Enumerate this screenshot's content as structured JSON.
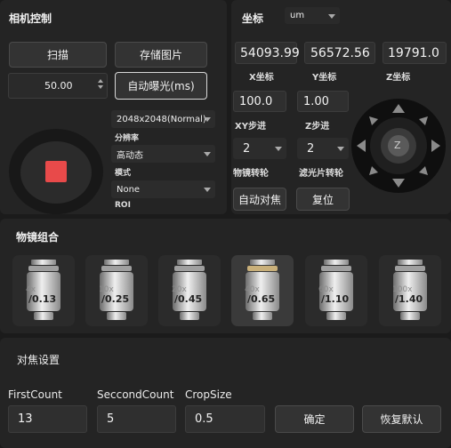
{
  "machine_control": {
    "title": "相机控制",
    "scan_label": "扫描",
    "save_image_label": "存储图片",
    "exposure_value": "50.00",
    "auto_exposure_label": "自动曝光(ms)",
    "resolution_value": "2048x2048(Normal)",
    "resolution_label": "分辨率",
    "mode_value": "高动态",
    "mode_label": "模式",
    "roi_value": "None",
    "roi_label": "ROI",
    "record_color": "#e84a4a"
  },
  "coordinates": {
    "title": "坐标",
    "unit_value": "um",
    "x_value": "54093.99",
    "y_value": "56572.56",
    "z_value": "19791.0",
    "x_label": "X坐标",
    "y_label": "Y坐标",
    "z_label": "Z坐标",
    "xy_step_value": "100.0",
    "z_step_value": "1.00",
    "xy_step_label": "XY步进",
    "z_step_label": "Z步进",
    "objective_wheel_value": "2",
    "filter_wheel_value": "2",
    "objective_wheel_label": "物镜转轮",
    "filter_wheel_label": "滤光片转轮",
    "autofocus_label": "自动对焦",
    "reset_label": "复位",
    "z_knob_label": "Z"
  },
  "objectives": {
    "title": "物镜组合",
    "items": [
      {
        "mag": "4x",
        "na": "/0.13",
        "selected": false
      },
      {
        "mag": "10x",
        "na": "/0.25",
        "selected": false
      },
      {
        "mag": "20x",
        "na": "/0.45",
        "selected": false
      },
      {
        "mag": "40x",
        "na": "/0.65",
        "selected": true
      },
      {
        "mag": "60x",
        "na": "/1.10",
        "selected": false
      },
      {
        "mag": "100x",
        "na": "/1.40",
        "selected": false
      }
    ]
  },
  "focus": {
    "title": "对焦设置",
    "first_count_label": "FirstCount",
    "second_count_label": "SeccondCount",
    "crop_size_label": "CropSize",
    "first_count_value": "13",
    "second_count_value": "5",
    "crop_size_value": "0.5",
    "confirm_label": "确定",
    "restore_default_label": "恢复默认"
  }
}
